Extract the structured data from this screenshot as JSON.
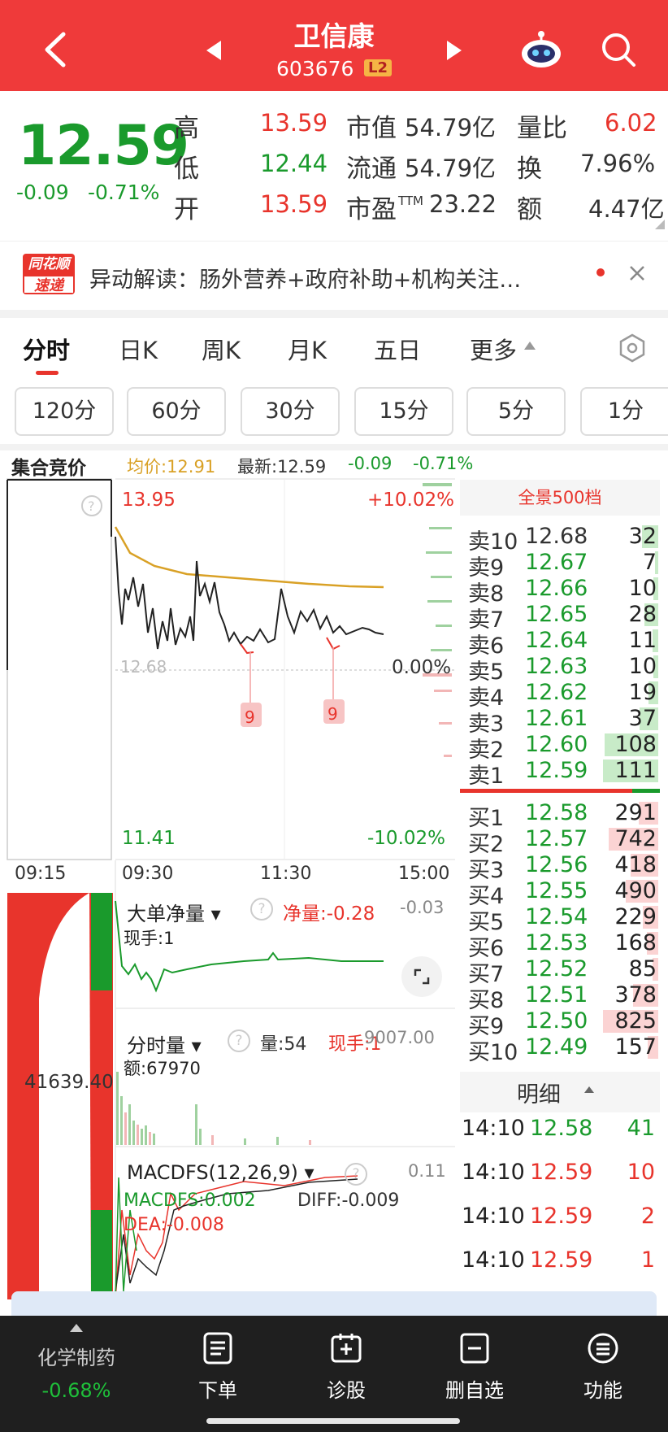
{
  "header": {
    "title": "卫信康",
    "code": "603676",
    "level_badge": "L2"
  },
  "quote": {
    "price": "12.59",
    "change": "-0.09",
    "change_pct": "-0.71%",
    "high_label": "高",
    "high": "13.59",
    "low_label": "低",
    "low": "12.44",
    "open_label": "开",
    "open": "13.59",
    "mcap_label": "市值",
    "mcap": "54.79亿",
    "float_label": "流通",
    "float": "54.79亿",
    "pe_label": "市盈",
    "pe_sup": "TTM",
    "pe": "23.22",
    "vr_label": "量比",
    "vr": "6.02",
    "turnover_label": "换",
    "turnover": "7.96%",
    "amount_label": "额",
    "amount": "4.47亿"
  },
  "news": {
    "badge_top": "同花顺",
    "badge_bottom": "速递",
    "text": "异动解读：肠外营养+政府补助+机构关注…"
  },
  "tabs": [
    "分时",
    "日K",
    "周K",
    "月K",
    "五日",
    "更多"
  ],
  "periods": [
    "120分",
    "60分",
    "30分",
    "15分",
    "5分",
    "1分"
  ],
  "chart": {
    "auction_label": "集合竞价",
    "avg_text": "均价:12.91",
    "latest_text": "最新:12.59",
    "chg_text": "-0.09",
    "pct_text": "-0.71%",
    "top_price": "13.95",
    "top_pct": "+10.02%",
    "zero_pct": "0.00%",
    "ref_price": "12.68",
    "bottom_price": "11.41",
    "bottom_pct": "-10.02%",
    "marker": "9",
    "times": [
      "09:15",
      "09:30",
      "11:30",
      "15:00"
    ]
  },
  "bigorder": {
    "title": "大单净量",
    "net_label": "净量:",
    "net_value": "-0.28",
    "right_value": "-0.03",
    "hand": "现手:1"
  },
  "left_volume": "41639.40",
  "timevol": {
    "title": "分时量",
    "vol": "量:54",
    "hand": "现手:1",
    "right_value": "9007.00",
    "amt": "额:67970"
  },
  "macd": {
    "title": "MACDFS(12,26,9)",
    "right_value": "0.11",
    "macd": "MACDFS:0.002",
    "dif": "DIFF:-0.009",
    "dea": "DEA:-0.008"
  },
  "orderbook": {
    "title": "全景500档",
    "asks": [
      {
        "label": "卖10",
        "price": "12.68",
        "vol": "32"
      },
      {
        "label": "卖9",
        "price": "12.67",
        "vol": "7"
      },
      {
        "label": "卖8",
        "price": "12.66",
        "vol": "10"
      },
      {
        "label": "卖7",
        "price": "12.65",
        "vol": "28"
      },
      {
        "label": "卖6",
        "price": "12.64",
        "vol": "11"
      },
      {
        "label": "卖5",
        "price": "12.63",
        "vol": "10"
      },
      {
        "label": "卖4",
        "price": "12.62",
        "vol": "19"
      },
      {
        "label": "卖3",
        "price": "12.61",
        "vol": "37"
      },
      {
        "label": "卖2",
        "price": "12.60",
        "vol": "108"
      },
      {
        "label": "卖1",
        "price": "12.59",
        "vol": "111"
      }
    ],
    "bids": [
      {
        "label": "买1",
        "price": "12.58",
        "vol": "291"
      },
      {
        "label": "买2",
        "price": "12.57",
        "vol": "742"
      },
      {
        "label": "买3",
        "price": "12.56",
        "vol": "418"
      },
      {
        "label": "买4",
        "price": "12.55",
        "vol": "490"
      },
      {
        "label": "买5",
        "price": "12.54",
        "vol": "229"
      },
      {
        "label": "买6",
        "price": "12.53",
        "vol": "168"
      },
      {
        "label": "买7",
        "price": "12.52",
        "vol": "85"
      },
      {
        "label": "买8",
        "price": "12.51",
        "vol": "378"
      },
      {
        "label": "买9",
        "price": "12.50",
        "vol": "825"
      },
      {
        "label": "买10",
        "price": "12.49",
        "vol": "157"
      }
    ]
  },
  "details": {
    "title": "明细",
    "rows": [
      {
        "time": "14:10",
        "price": "12.58",
        "vol": "41"
      },
      {
        "time": "14:10",
        "price": "12.59",
        "vol": "10"
      },
      {
        "time": "14:10",
        "price": "12.59",
        "vol": "2"
      },
      {
        "time": "14:10",
        "price": "12.59",
        "vol": "1"
      }
    ]
  },
  "bottom": {
    "sector": "化学制药",
    "sector_pct": "-0.68%",
    "order": "下单",
    "diagnose": "诊股",
    "remove": "删自选",
    "functions": "功能"
  },
  "colors": {
    "up": "#e8342c",
    "down": "#1a9a2c",
    "header": "#ef3a3a",
    "avg_line": "#d9a126"
  }
}
